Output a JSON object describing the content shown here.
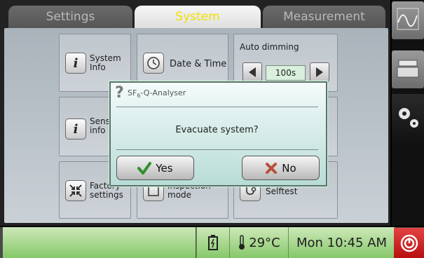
{
  "tabs": {
    "settings": "Settings",
    "system": "System",
    "measurement": "Measurement"
  },
  "tiles": {
    "system_info": [
      "System",
      "Info"
    ],
    "date_time": "Date & Time",
    "auto_dimming": "Auto dimming",
    "dimming_value": "100s",
    "sensor_info": [
      "Sens",
      "info"
    ],
    "factory_settings": [
      "Factory",
      "settings"
    ],
    "inspection_mode": [
      "inspection",
      "mode"
    ],
    "selftest": "Selftest"
  },
  "status": {
    "temperature": "29°C",
    "clock": "Mon 10:45 AM"
  },
  "dialog": {
    "title_prefix": "SF",
    "title_sub": "6",
    "title_suffix": "-Q-Analyser",
    "message": "Evacuate system?",
    "yes_label": "Yes",
    "no_label": "No"
  },
  "icons": {
    "sidebar": [
      "chart-icon",
      "tray-icon",
      "gears-icon"
    ],
    "battery": "battery-icon",
    "thermometer": "thermometer-icon",
    "power": "power-icon"
  },
  "colors": {
    "system_tab_text": "#f0e000",
    "status_green": "#86c86a",
    "power_red": "#d11f1f",
    "yes_check": "#2f8f2f",
    "no_x": "#b8503a"
  }
}
